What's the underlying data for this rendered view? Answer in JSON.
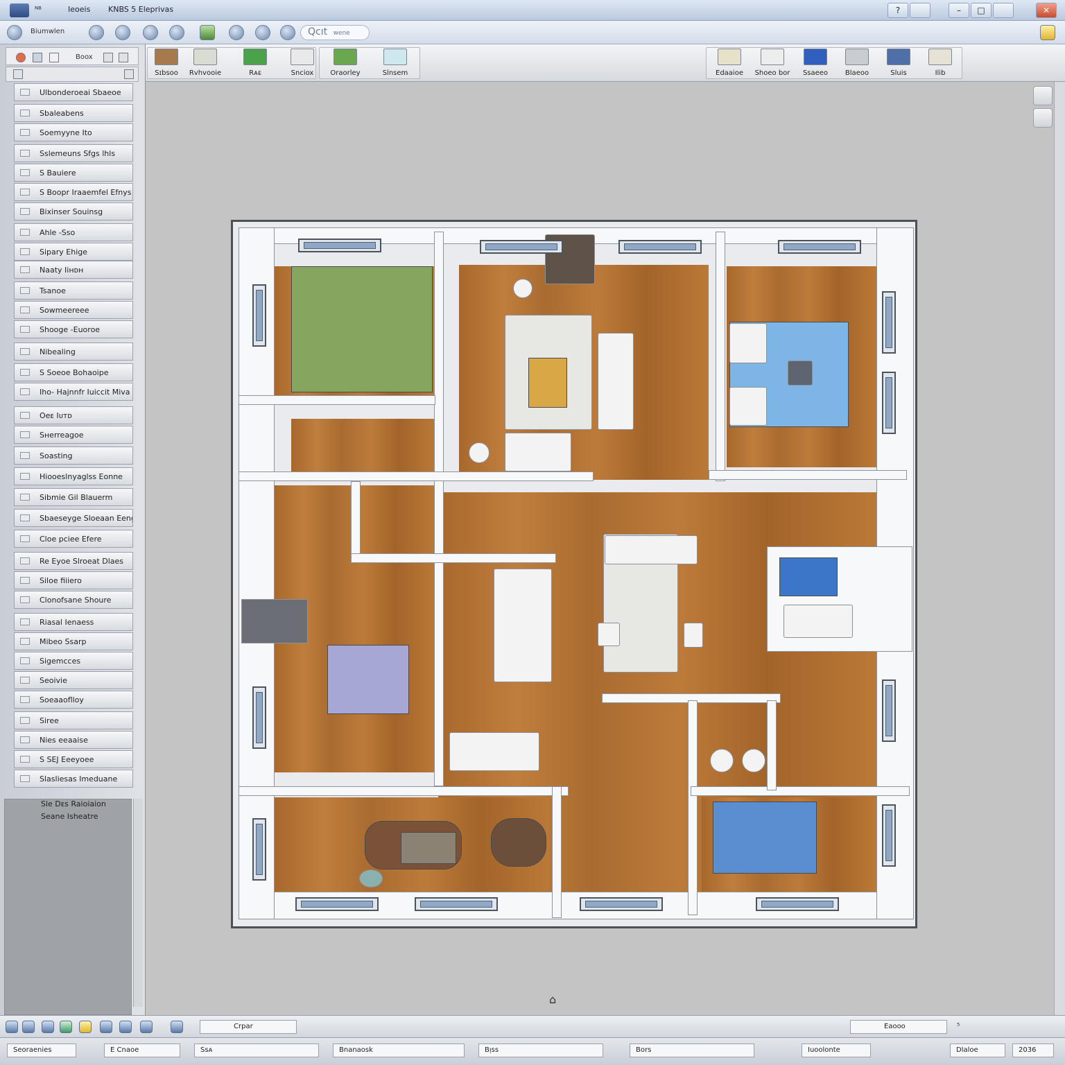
{
  "titlebar": {
    "app_short": "ᴺᴮ",
    "doc_label": "Ieoeis",
    "title": "KNBS 5 Eleprivas",
    "buttons": {
      "help": "?",
      "minimize": "–",
      "maximize": "□",
      "close": "✕"
    }
  },
  "quickbar": {
    "label": "Biumwlen",
    "search": "Qcıt",
    "search_hint": "wene"
  },
  "ribbon": {
    "left_buttons": [
      "Sɪbsoo",
      "Rvhvooie",
      "Rᴀᴇ",
      "Snciox",
      "Oraorley",
      "Slnsem"
    ],
    "right_buttons": [
      "Edaaioe",
      "Shoeo bor",
      "Ssaeeo",
      "Blaeoo",
      "Sluis",
      "Ilib"
    ]
  },
  "left_panel": {
    "header_label": "Boox",
    "items": [
      "Ulbonderoeai Sbaeoe",
      "Sbaleabens",
      "Soemyyne Ito",
      "Sslemeuns Sfgs lhls",
      "S Bauiere",
      "S Boopr Iraaemfel Efnys",
      "Bixinser Souinsg",
      "Ahle -Sso",
      "Sipary Ehige",
      "Naaty Iiʜᴅʜ",
      "Tsanoe",
      "Sowmeereee",
      "Shooge -Euoroe",
      "Nibealing",
      "S Soeoe Bohaoipe",
      "Iho- Hajnnfr Iuiccit Miva",
      "Oeᴇ Iᴜᴛᴅ",
      "Sʜerreagoe",
      "Soasting",
      "Hiooeslnyaglss Eonne",
      "Sibmie Gil Blauerm",
      "Sbaeseyge Sloeaan Eeng",
      "Cloe pciee Efere",
      "Re Eyoe Slroeat Dlaes",
      "Siloe fiiiero",
      "Clonofsane Shoure",
      "Riasal Ienaess",
      "Mibeo Ssarp",
      "Sigemcces",
      "Seoivie",
      "Soeaaoflloy",
      "Siree",
      "Nies eeaaise",
      "S SEJ Eeeyoee",
      "Slasliesas Imeduane"
    ],
    "footer_line1": "Sle Dᴇs Raioiaion",
    "footer_line2": "Seane Isheatre"
  },
  "status1": {
    "dropdown_label": "Crpar",
    "zoom_label": "Eaooo",
    "zoom_arrow": "⁵"
  },
  "status2": {
    "fields": [
      "Seoraenies",
      "E Cnaoe",
      "Ssᴀ",
      "Bnanaosk",
      "Bᴉss",
      "Bors",
      "Iuoolonte",
      "Dlaloe",
      "2036"
    ]
  },
  "colors": {
    "floor": "#b3733a",
    "green_bed": "#86a660",
    "blue_bed": "#7db5e6",
    "lavender_bed": "#a7a7d6",
    "blue_rug": "#5b8ed0",
    "close_button": "#c84a2e"
  },
  "icons": [
    "app-icon",
    "search-icon",
    "globe-icon",
    "cursor-icon"
  ]
}
